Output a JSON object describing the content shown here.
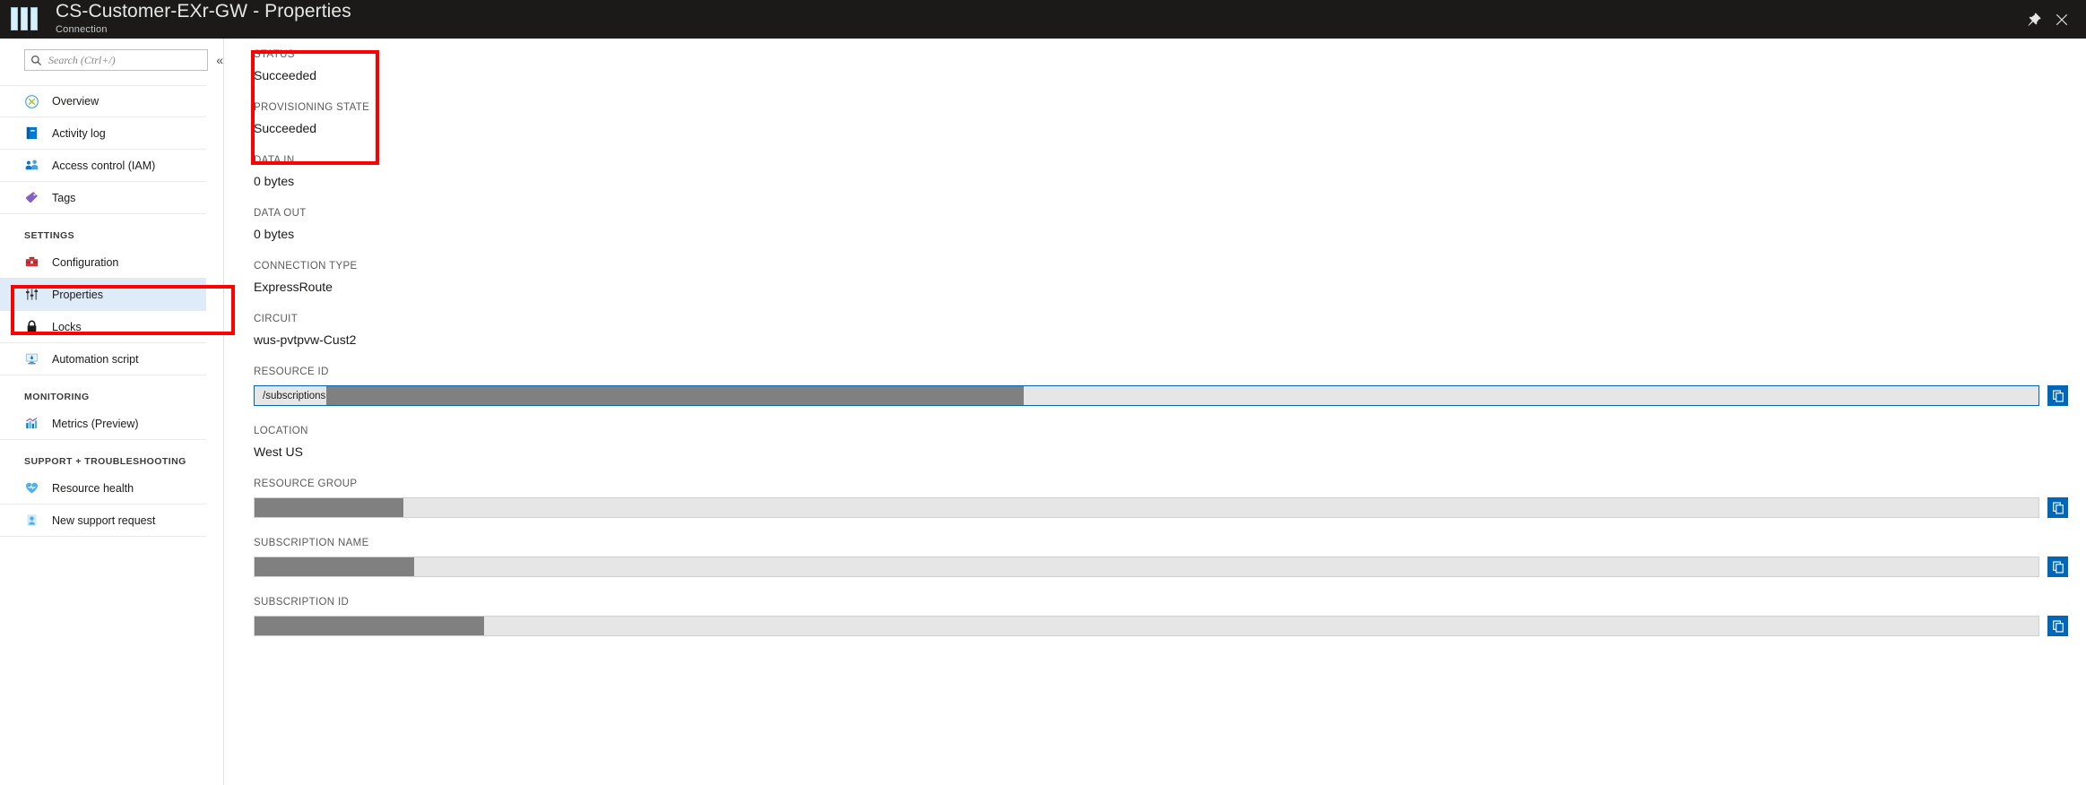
{
  "titlebar": {
    "title": "CS-Customer-EXr-GW - Properties",
    "subtitle": "Connection",
    "pin_icon": "pin-icon",
    "close_icon": "close-icon"
  },
  "sidebar": {
    "search": {
      "placeholder": "Search (Ctrl+/)",
      "value": "",
      "icon": "search-icon"
    },
    "collapse_label": "«",
    "items": [
      {
        "label": "Overview",
        "icon": "overview-icon",
        "selected": false
      },
      {
        "label": "Activity log",
        "icon": "activity-log-icon",
        "selected": false
      },
      {
        "label": "Access control (IAM)",
        "icon": "access-control-icon",
        "selected": false
      },
      {
        "label": "Tags",
        "icon": "tag-icon",
        "selected": false
      }
    ],
    "groups": [
      {
        "label": "SETTINGS",
        "items": [
          {
            "label": "Configuration",
            "icon": "configuration-icon",
            "selected": false
          },
          {
            "label": "Properties",
            "icon": "properties-icon",
            "selected": true
          },
          {
            "label": "Locks",
            "icon": "lock-icon",
            "selected": false
          },
          {
            "label": "Automation script",
            "icon": "automation-script-icon",
            "selected": false
          }
        ]
      },
      {
        "label": "MONITORING",
        "items": [
          {
            "label": "Metrics (Preview)",
            "icon": "metrics-icon",
            "selected": false
          }
        ]
      },
      {
        "label": "SUPPORT + TROUBLESHOOTING",
        "items": [
          {
            "label": "Resource health",
            "icon": "resource-health-icon",
            "selected": false
          },
          {
            "label": "New support request",
            "icon": "support-request-icon",
            "selected": false
          }
        ]
      }
    ]
  },
  "properties": {
    "status": {
      "label": "STATUS",
      "value": "Succeeded"
    },
    "provisioning_state": {
      "label": "PROVISIONING STATE",
      "value": "Succeeded"
    },
    "data_in": {
      "label": "DATA IN",
      "value": "0 bytes"
    },
    "data_out": {
      "label": "DATA OUT",
      "value": "0 bytes"
    },
    "connection_type": {
      "label": "CONNECTION TYPE",
      "value": "ExpressRoute"
    },
    "circuit": {
      "label": "CIRCUIT",
      "value": "wus-pvtpvw-Cust2"
    },
    "resource_id": {
      "label": "RESOURCE ID",
      "value": "/subscriptions"
    },
    "location": {
      "label": "LOCATION",
      "value": "West US"
    },
    "resource_group": {
      "label": "RESOURCE GROUP",
      "value": ""
    },
    "subscription_name": {
      "label": "SUBSCRIPTION NAME",
      "value": ""
    },
    "subscription_id": {
      "label": "SUBSCRIPTION ID",
      "value": ""
    }
  },
  "copy_button": {
    "icon": "copy-to-clipboard-icon",
    "label": ""
  },
  "colors": {
    "topbar_background": "#1b1a19",
    "selected_item_background": "#deecf9",
    "annotation_red": "#ff0000",
    "accent_blue": "#0067b8",
    "redaction_gray": "#808080"
  }
}
